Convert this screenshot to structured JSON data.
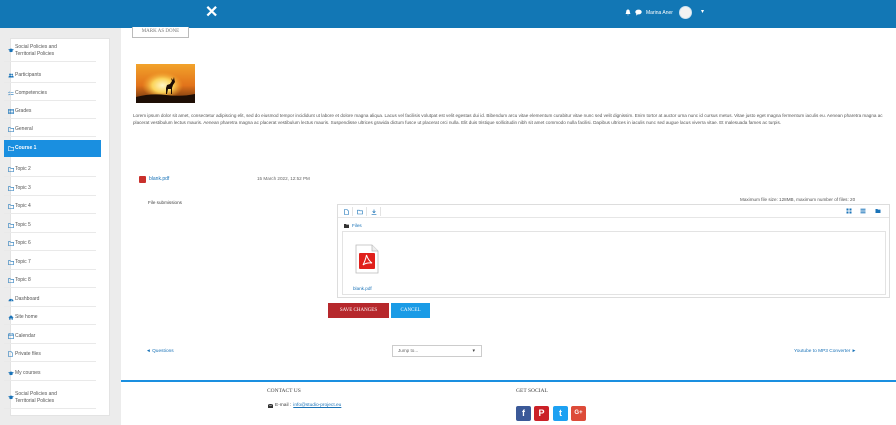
{
  "topbar": {
    "close_glyph": "✕",
    "user_name": "Marina Aner",
    "caret": "▾",
    "icons": [
      "bell-icon",
      "chat-icon",
      "avatar",
      "chevron-down-icon"
    ],
    "bg_color": "#1277b5"
  },
  "sidebar": {
    "items": [
      {
        "label": "Social Policies and",
        "label2": "Territorial Policies",
        "icon": "graduation-cap-icon"
      },
      {
        "label": "Participants",
        "icon": "users-icon"
      },
      {
        "label": "Competencies",
        "icon": "check-list-icon"
      },
      {
        "label": "Grades",
        "icon": "table-icon"
      },
      {
        "label": "General",
        "icon": "folder-icon"
      },
      {
        "label": "Course 1",
        "icon": "folder-icon",
        "active": true
      },
      {
        "label": "Topic 2",
        "icon": "folder-icon"
      },
      {
        "label": "Topic 3",
        "icon": "folder-icon"
      },
      {
        "label": "Topic 4",
        "icon": "folder-icon"
      },
      {
        "label": "Topic 5",
        "icon": "folder-icon"
      },
      {
        "label": "Topic 6",
        "icon": "folder-icon"
      },
      {
        "label": "Topic 7",
        "icon": "folder-icon"
      },
      {
        "label": "Topic 8",
        "icon": "folder-icon"
      },
      {
        "label": "Dashboard",
        "icon": "dashboard-icon"
      },
      {
        "label": "Site home",
        "icon": "home-icon"
      },
      {
        "label": "Calendar",
        "icon": "calendar-icon"
      },
      {
        "label": "Private files",
        "icon": "file-icon"
      },
      {
        "label": "My courses",
        "icon": "graduation-cap-icon"
      },
      {
        "label": "Social Policies and",
        "label2": "Territorial Policies",
        "icon": "graduation-cap-icon"
      }
    ],
    "active_color": "#1a8fe0"
  },
  "main": {
    "marked_done": "MARK AS DONE",
    "lorem": "Lorem ipsum dolor sit amet, consectetur adipiscing elit, sed do eiusmod tempor incididunt ut labore et dolore magna aliqua. Lacus vel facilisis volutpat est velit egestas dui id. Bibendum arcu vitae elementum curabitur vitae nunc sed velit dignissim. Enim tortor at auctor urna nunc id cursus metus. Vitae justo eget magna fermentum iaculis eu. Aenean pharetra magna ac placerat vestibulum lectus mauris. Aenean pharetra magna ac placerat vestibulum lectus mauris. Suspendisse ultrices gravida dictum fusce ut placerat orci nulla. Elit duis tristique sollicitudin nibh sit amet commodo nulla facilisi. Dapibus ultrices in iaculis nunc sed augue lacus viverra vitae. Et malesuada fames ac turpis.",
    "file": {
      "name": "blank.pdf",
      "date": "15 March 2022, 12:52 PM"
    },
    "file_submissions_label": "File submissions",
    "max_size": "Maximum file size: 128MB, maximum number of files: 20",
    "file_manager": {
      "path_label": "Files",
      "file_name": "blank.pdf"
    },
    "save_label": "SAVE CHANGES",
    "cancel_label": "CANCEL",
    "prev_link": "◄ Questions",
    "jump_placeholder": "Jump to...",
    "jump_caret": "▾",
    "next_link": "Youtube to MP3 Converter ►"
  },
  "footer": {
    "contact_title": "CONTACT US",
    "email_label": "E-mail :",
    "email_address": "info@studio-project.eu",
    "social_title": "GET SOCIAL",
    "social": [
      {
        "name": "facebook",
        "glyph": "f",
        "color": "#3b5998"
      },
      {
        "name": "pinterest",
        "glyph": "P",
        "color": "#cb2027"
      },
      {
        "name": "twitter",
        "glyph": "t",
        "color": "#1da1f2"
      },
      {
        "name": "google-plus",
        "glyph": "G+",
        "color": "#dd4b39"
      }
    ]
  }
}
